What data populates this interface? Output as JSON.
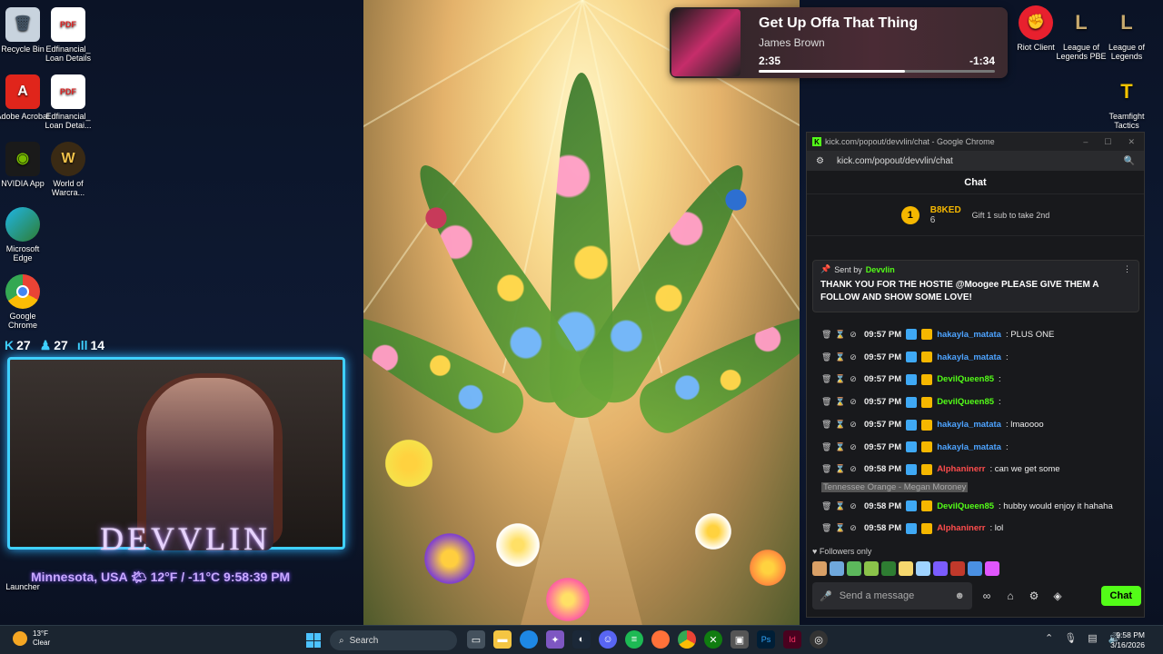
{
  "desktop_left": [
    {
      "label": "Recycle Bin",
      "icon": "recycle-bin-icon"
    },
    {
      "label": "Edfinancial_ Loan Details",
      "icon": "pdf-icon"
    },
    {
      "label": "Adobe Acrobat",
      "icon": "acrobat-icon"
    },
    {
      "label": "Edfinancial_ Loan Detai...",
      "icon": "pdf-icon"
    },
    {
      "label": "NVIDIA App",
      "icon": "nvidia-icon"
    },
    {
      "label": "World of Warcra...",
      "icon": "wow-icon"
    },
    {
      "label": "Microsoft Edge",
      "icon": "edge-icon"
    },
    {
      "label": "Google Chrome",
      "icon": "chrome-icon"
    },
    {
      "label": "Launcher",
      "icon": "launcher-icon"
    }
  ],
  "desktop_right": [
    {
      "label": "Riot Client",
      "icon": "riot-icon"
    },
    {
      "label": "League of Legends PBE",
      "icon": "lol-pbe-icon"
    },
    {
      "label": "League of Legends",
      "icon": "lol-icon"
    },
    {
      "label": "Teamfight Tactics",
      "icon": "tft-icon"
    }
  ],
  "stream_stats": {
    "kick": "27",
    "followers": "27",
    "viewers": "14"
  },
  "overlay": {
    "brand": "DEVVLIN",
    "weather_line": "Minnesota, USA 🌤 12°F / -11°C 9:58:39 PM"
  },
  "media": {
    "title": "Get Up Offa That Thing",
    "artist": "James Brown",
    "elapsed": "2:35",
    "remaining": "-1:34",
    "progress": 0.62
  },
  "chat_window": {
    "title": "kick.com/popout/devvlin/chat - Google Chrome",
    "url": "kick.com/popout/devvlin/chat",
    "header": "Chat",
    "gifter": {
      "rank": "1",
      "name": "B8KED",
      "count": "6",
      "gift_text": "Gift 1 sub to take 2nd"
    },
    "pinned": {
      "sent_by_label": "Sent by",
      "sender": "Devvlin",
      "message": "THANK YOU FOR THE HOSTIE @Moogee PLEASE GIVE THEM A FOLLOW AND SHOW SOME LOVE!"
    },
    "messages": [
      {
        "time": "09:57 PM",
        "user": "hakayla_matata",
        "user_color": "#4da3ff",
        "text": ": PLUS ONE"
      },
      {
        "time": "09:57 PM",
        "user": "hakayla_matata",
        "user_color": "#4da3ff",
        "text": ":"
      },
      {
        "time": "09:57 PM",
        "user": "DevilQueen85",
        "user_color": "#53fc18",
        "text": ":"
      },
      {
        "time": "09:57 PM",
        "user": "DevilQueen85",
        "user_color": "#53fc18",
        "text": ":"
      },
      {
        "time": "09:57 PM",
        "user": "hakayla_matata",
        "user_color": "#4da3ff",
        "text": ": lmaoooo"
      },
      {
        "time": "09:57 PM",
        "user": "hakayla_matata",
        "user_color": "#4da3ff",
        "text": ":"
      },
      {
        "time": "09:58 PM",
        "user": "Alphaninerr",
        "user_color": "#ff4d4d",
        "text": ": can we get some",
        "highlight": "Tennessee Orange - Megan Moroney"
      },
      {
        "time": "09:58 PM",
        "user": "DevilQueen85",
        "user_color": "#53fc18",
        "text": ": hubby would enjoy it hahaha"
      },
      {
        "time": "09:58 PM",
        "user": "Alphaninerr",
        "user_color": "#ff4d4d",
        "text": ": lol"
      }
    ],
    "followers_only": "Followers only",
    "send_placeholder": "Send a message",
    "chat_button": "Chat",
    "accent": "#53fc18"
  },
  "taskbar": {
    "weather_temp": "13°F",
    "weather_desc": "Clear",
    "search_placeholder": "Search",
    "time": "9:58 PM",
    "date": "3/16/2026"
  }
}
